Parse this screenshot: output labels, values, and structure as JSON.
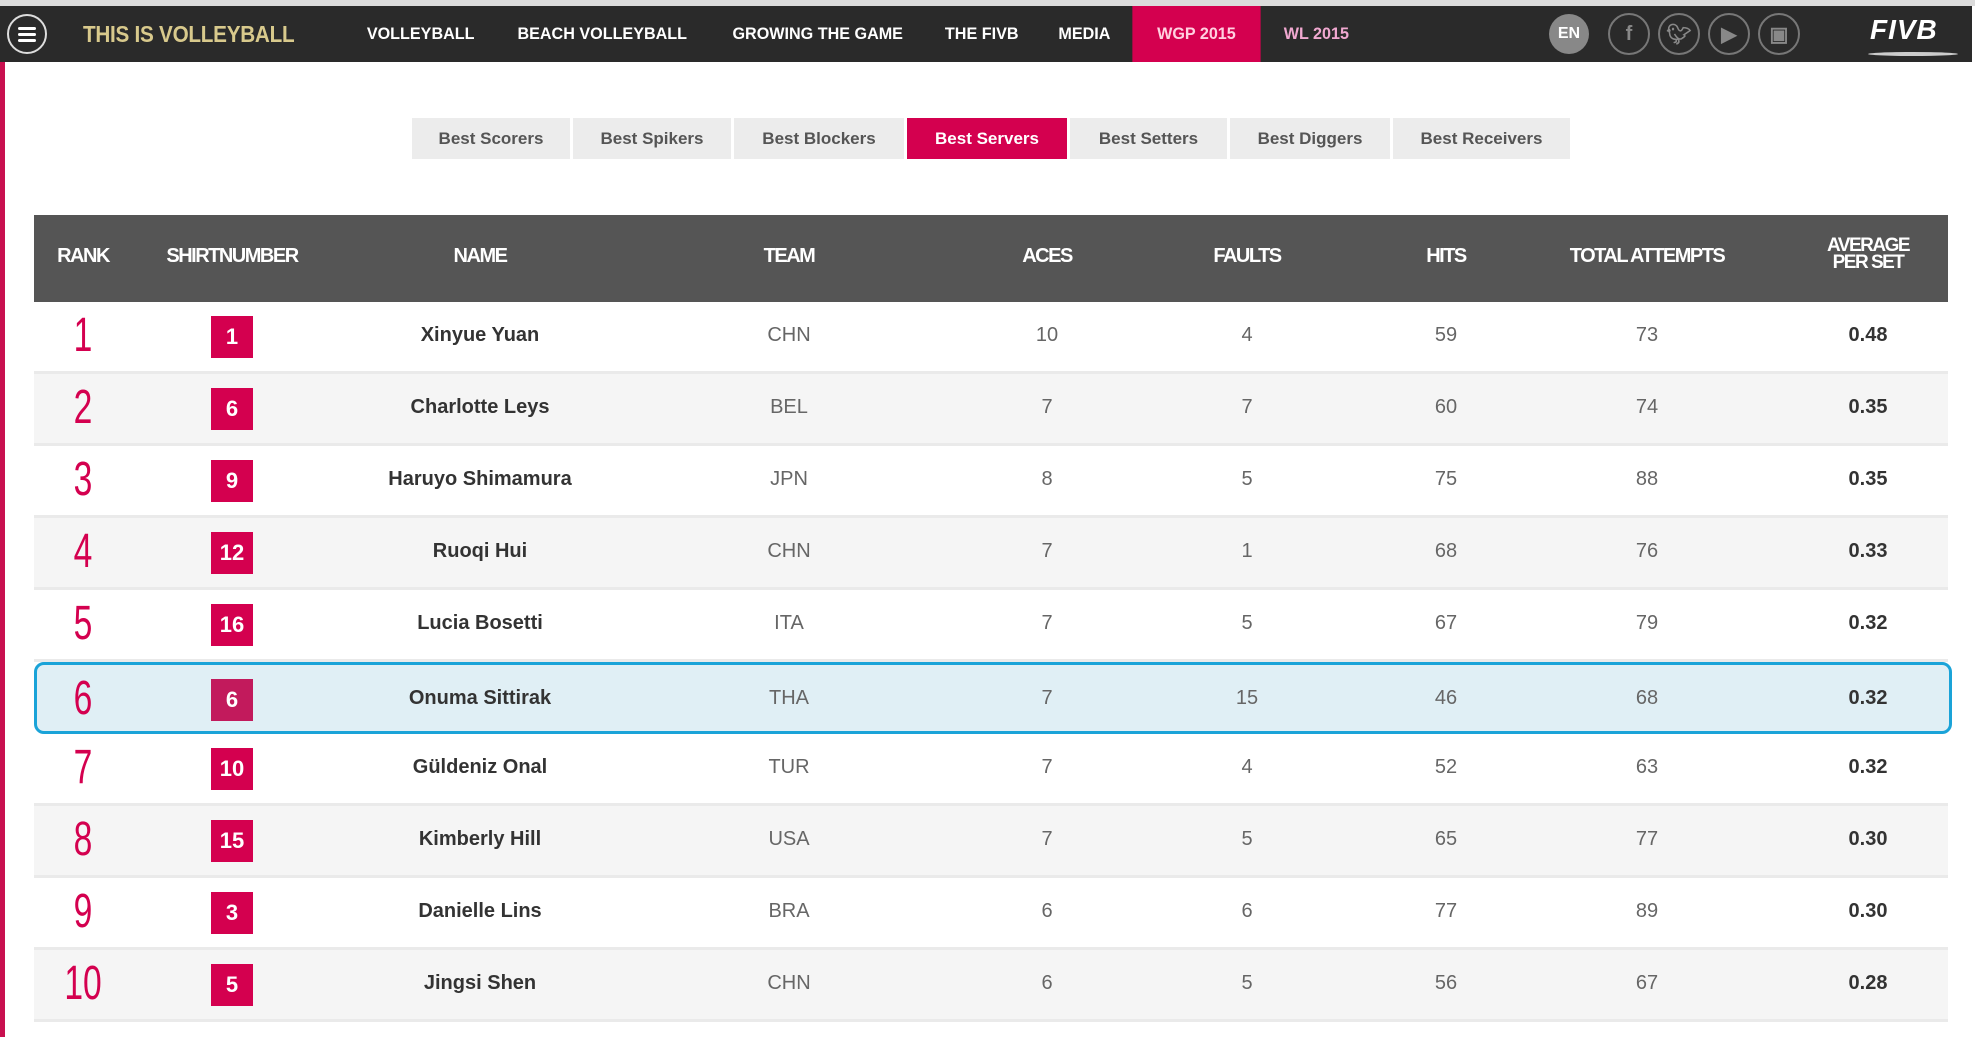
{
  "nav": {
    "brand": "THIS IS VOLLEYBALL",
    "items": [
      "VOLLEYBALL",
      "BEACH VOLLEYBALL",
      "GROWING THE GAME",
      "THE FIVB",
      "MEDIA",
      "WGP 2015",
      "WL 2015"
    ],
    "active": "WGP 2015",
    "lang": "EN",
    "social": [
      "facebook-icon",
      "twitter-icon",
      "youtube-icon",
      "instagram-icon"
    ],
    "logo": "FIVB"
  },
  "tabs": [
    "Best Scorers",
    "Best Spikers",
    "Best Blockers",
    "Best Servers",
    "Best Setters",
    "Best Diggers",
    "Best Receivers"
  ],
  "active_tab": "Best Servers",
  "table": {
    "headers": [
      "RANK",
      "SHIRTNUMBER",
      "NAME",
      "TEAM",
      "ACES",
      "FAULTS",
      "HITS",
      "TOTAL ATTEMPTS",
      "AVERAGE PER SET"
    ],
    "highlighted_rank": "6",
    "rows": [
      [
        "1",
        "1",
        "Xinyue Yuan",
        "CHN",
        "10",
        "4",
        "59",
        "73",
        "0.48"
      ],
      [
        "2",
        "6",
        "Charlotte Leys",
        "BEL",
        "7",
        "7",
        "60",
        "74",
        "0.35"
      ],
      [
        "3",
        "9",
        "Haruyo Shimamura",
        "JPN",
        "8",
        "5",
        "75",
        "88",
        "0.35"
      ],
      [
        "4",
        "12",
        "Ruoqi Hui",
        "CHN",
        "7",
        "1",
        "68",
        "76",
        "0.33"
      ],
      [
        "5",
        "16",
        "Lucia Bosetti",
        "ITA",
        "7",
        "5",
        "67",
        "79",
        "0.32"
      ],
      [
        "6",
        "6",
        "Onuma Sittirak",
        "THA",
        "7",
        "15",
        "46",
        "68",
        "0.32"
      ],
      [
        "7",
        "10",
        "Güldeniz Onal",
        "TUR",
        "7",
        "4",
        "52",
        "63",
        "0.32"
      ],
      [
        "8",
        "15",
        "Kimberly Hill",
        "USA",
        "7",
        "5",
        "65",
        "77",
        "0.30"
      ],
      [
        "9",
        "3",
        "Danielle Lins",
        "BRA",
        "6",
        "6",
        "77",
        "89",
        "0.30"
      ],
      [
        "10",
        "5",
        "Jingsi Shen",
        "CHN",
        "6",
        "5",
        "56",
        "67",
        "0.28"
      ]
    ]
  },
  "colors": {
    "accent": "#d4004f",
    "nav_bg": "#2a2a2a",
    "header_bg": "#555555",
    "highlight_border": "#1aa3d8"
  }
}
